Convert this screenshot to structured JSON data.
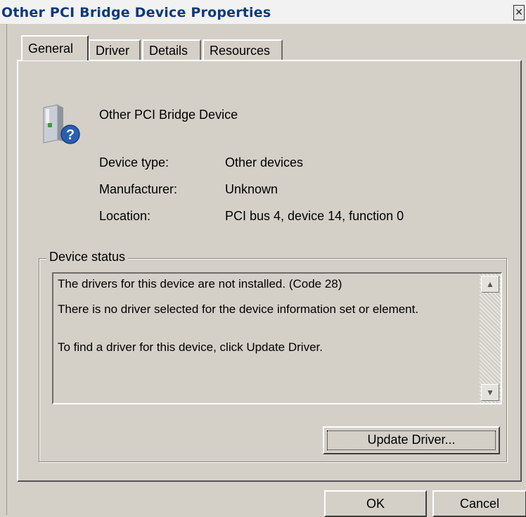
{
  "window": {
    "title": "Other PCI Bridge Device Properties",
    "close_glyph": "✕"
  },
  "tabs": [
    {
      "label": "General",
      "active": true
    },
    {
      "label": "Driver",
      "active": false
    },
    {
      "label": "Details",
      "active": false
    },
    {
      "label": "Resources",
      "active": false
    }
  ],
  "device": {
    "icon": "unknown-device-icon",
    "name": "Other PCI Bridge Device"
  },
  "properties": [
    {
      "label": "Device type:",
      "value": "Other devices"
    },
    {
      "label": "Manufacturer:",
      "value": "Unknown"
    },
    {
      "label": "Location:",
      "value": "PCI bus 4, device 14, function 0"
    }
  ],
  "status": {
    "group_label": "Device status",
    "lines": [
      "The drivers for this device are not installed. (Code 28)",
      "There is no driver selected for the device information set or element.",
      "To find a driver for this device, click Update Driver."
    ],
    "update_button": "Update Driver..."
  },
  "footer": {
    "ok": "OK",
    "cancel": "Cancel"
  }
}
